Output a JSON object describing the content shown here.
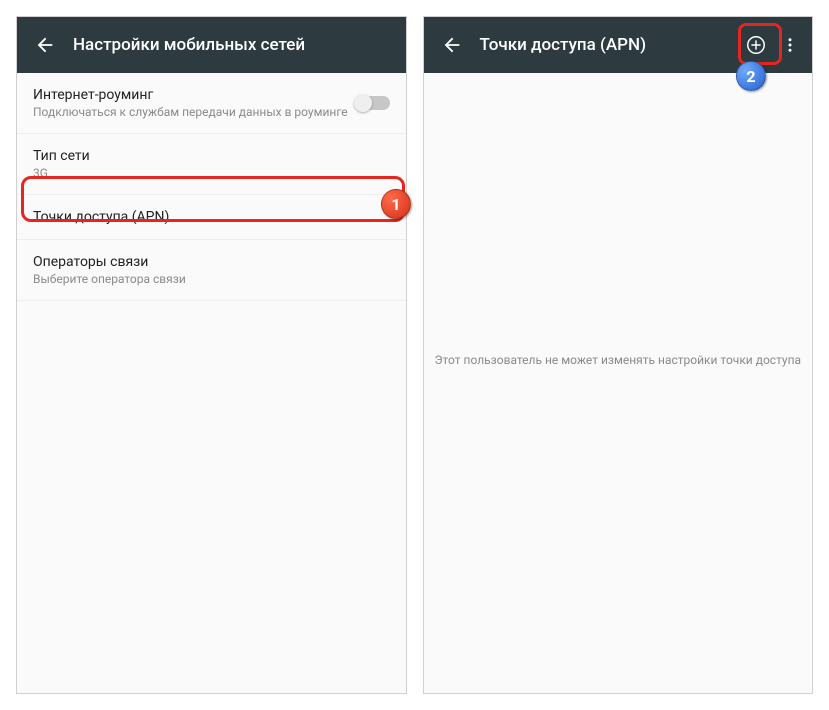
{
  "left": {
    "title": "Настройки мобильных сетей",
    "items": {
      "roaming": {
        "primary": "Интернет-роуминг",
        "secondary": "Подключаться к службам передачи данных в роуминге"
      },
      "network_type": {
        "primary": "Тип сети",
        "secondary": "3G"
      },
      "apn": {
        "primary": "Точки доступа (APN)"
      },
      "operators": {
        "primary": "Операторы связи",
        "secondary": "Выберите оператора связи"
      }
    }
  },
  "right": {
    "title": "Точки доступа (APN)",
    "empty": "Этот пользователь не может изменять настройки точки доступа"
  },
  "markers": {
    "one": "1",
    "two": "2"
  }
}
